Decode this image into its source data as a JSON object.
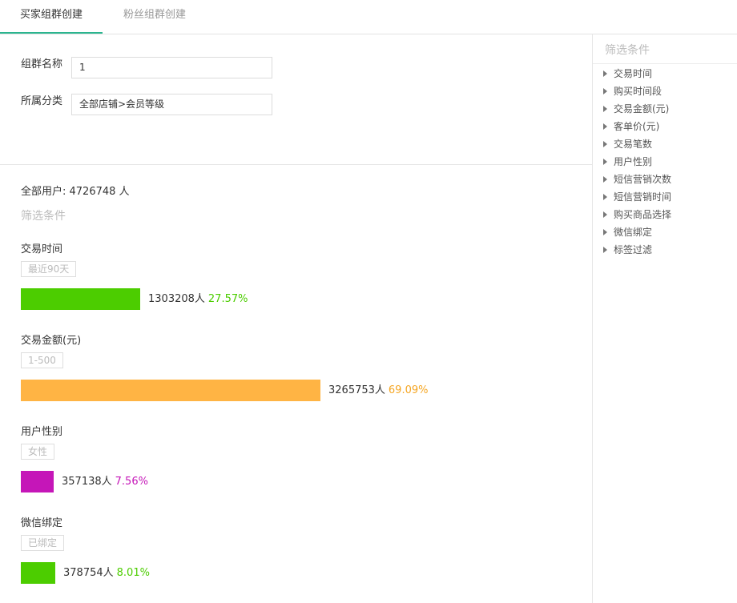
{
  "tabs": [
    {
      "label": "买家组群创建",
      "active": true
    },
    {
      "label": "粉丝组群创建",
      "active": false
    }
  ],
  "form": {
    "name_label": "组群名称",
    "name_value": "1",
    "category_label": "所属分类",
    "category_value": "全部店铺>会员等级"
  },
  "summary": {
    "prefix": "全部用户: ",
    "count": "4726748",
    "suffix": " 人"
  },
  "filter_title": "筛选条件",
  "sections": [
    {
      "title": "交易时间",
      "tag": "最近90天",
      "count": "1303208人",
      "percent": "27.57%",
      "fraction": 0.2757,
      "color": "#4ccd00",
      "pct_color": "#4ccd00"
    },
    {
      "title": "交易金额(元)",
      "tag": "1-500",
      "count": "3265753人",
      "percent": "69.09%",
      "fraction": 0.6909,
      "color": "#ffb444",
      "pct_color": "#f5a623"
    },
    {
      "title": "用户性别",
      "tag": "女性",
      "count": "357138人",
      "percent": "7.56%",
      "fraction": 0.0756,
      "color": "#c516b8",
      "pct_color": "#c516b8"
    },
    {
      "title": "微信绑定",
      "tag": "已绑定",
      "count": "378754人",
      "percent": "8.01%",
      "fraction": 0.0801,
      "color": "#4ccd00",
      "pct_color": "#4ccd00"
    }
  ],
  "sidebar": {
    "title": "筛选条件",
    "items": [
      "交易时间",
      "购买时间段",
      "交易金额(元)",
      "客单价(元)",
      "交易笔数",
      "用户性别",
      "短信营销次数",
      "短信营销时间",
      "购买商品选择",
      "微信绑定",
      "标签过滤"
    ]
  },
  "colors": {
    "tab_accent": "#2bb58f"
  }
}
